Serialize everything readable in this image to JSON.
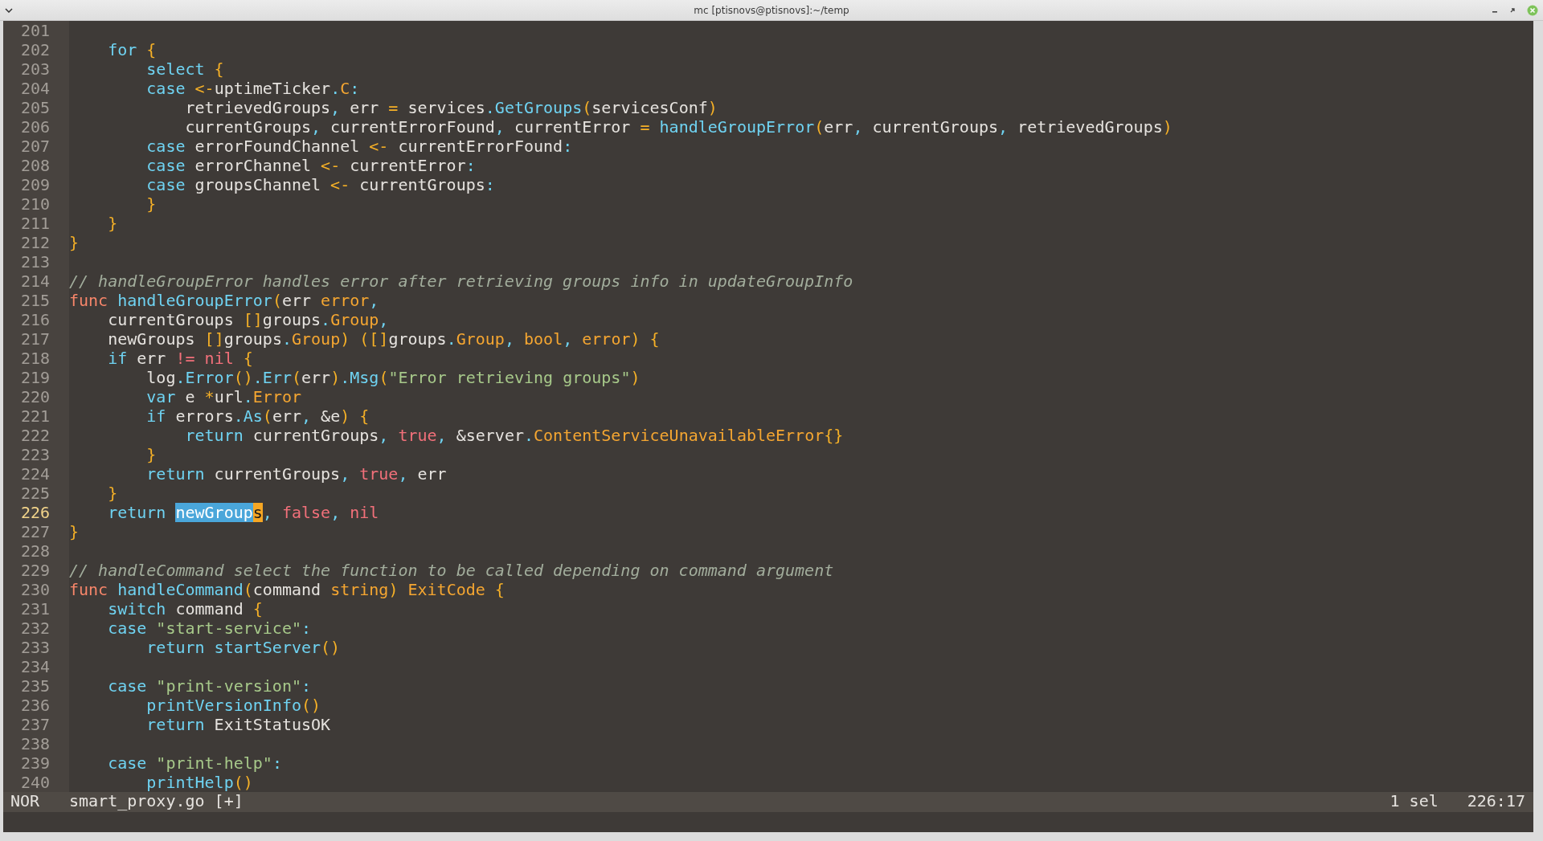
{
  "window": {
    "title": "mc [ptisnovs@ptisnovs]:~/temp"
  },
  "editor": {
    "lines": [
      {
        "number": "201",
        "current": false
      },
      {
        "number": "202",
        "current": false,
        "tokens": [
          {
            "kind": "keyword",
            "text": "    for"
          },
          {
            "kind": "bracket",
            "text": " {"
          }
        ]
      },
      {
        "number": "203",
        "current": false,
        "tokens": [
          {
            "kind": "keyword",
            "text": "        select"
          },
          {
            "kind": "bracket",
            "text": " {"
          }
        ]
      },
      {
        "number": "204",
        "current": false,
        "tokens": [
          {
            "kind": "keyword",
            "text": "        case"
          },
          {
            "kind": "operator",
            "text": " <-"
          },
          {
            "kind": "plain",
            "text": "uptimeTicker"
          },
          {
            "kind": "delim",
            "text": "."
          },
          {
            "kind": "type",
            "text": "C"
          },
          {
            "kind": "delim",
            "text": ":"
          }
        ]
      },
      {
        "number": "205",
        "current": false,
        "tokens": [
          {
            "kind": "plain",
            "text": "            retrievedGroups"
          },
          {
            "kind": "delim",
            "text": ","
          },
          {
            "kind": "plain",
            "text": " err"
          },
          {
            "kind": "operator",
            "text": " ="
          },
          {
            "kind": "plain",
            "text": " services"
          },
          {
            "kind": "delim",
            "text": "."
          },
          {
            "kind": "keyword",
            "text": "GetGroups"
          },
          {
            "kind": "bracket",
            "text": "("
          },
          {
            "kind": "plain",
            "text": "servicesConf"
          },
          {
            "kind": "bracket",
            "text": ")"
          }
        ]
      },
      {
        "number": "206",
        "current": false,
        "tokens": [
          {
            "kind": "plain",
            "text": "            currentGroups"
          },
          {
            "kind": "delim",
            "text": ","
          },
          {
            "kind": "plain",
            "text": " currentErrorFound"
          },
          {
            "kind": "delim",
            "text": ","
          },
          {
            "kind": "plain",
            "text": " currentError"
          },
          {
            "kind": "operator",
            "text": " ="
          },
          {
            "kind": "keyword",
            "text": " handleGroupError"
          },
          {
            "kind": "bracket",
            "text": "("
          },
          {
            "kind": "plain",
            "text": "err"
          },
          {
            "kind": "delim",
            "text": ","
          },
          {
            "kind": "plain",
            "text": " currentGroups"
          },
          {
            "kind": "delim",
            "text": ","
          },
          {
            "kind": "plain",
            "text": " retrievedGroups"
          },
          {
            "kind": "bracket",
            "text": ")"
          }
        ]
      },
      {
        "number": "207",
        "current": false,
        "tokens": [
          {
            "kind": "keyword",
            "text": "        case"
          },
          {
            "kind": "plain",
            "text": " errorFoundChannel"
          },
          {
            "kind": "operator",
            "text": " <-"
          },
          {
            "kind": "plain",
            "text": " currentErrorFound"
          },
          {
            "kind": "delim",
            "text": ":"
          }
        ]
      },
      {
        "number": "208",
        "current": false,
        "tokens": [
          {
            "kind": "keyword",
            "text": "        case"
          },
          {
            "kind": "plain",
            "text": " errorChannel"
          },
          {
            "kind": "operator",
            "text": " <-"
          },
          {
            "kind": "plain",
            "text": " currentError"
          },
          {
            "kind": "delim",
            "text": ":"
          }
        ]
      },
      {
        "number": "209",
        "current": false,
        "tokens": [
          {
            "kind": "keyword",
            "text": "        case"
          },
          {
            "kind": "plain",
            "text": " groupsChannel"
          },
          {
            "kind": "operator",
            "text": " <-"
          },
          {
            "kind": "plain",
            "text": " currentGroups"
          },
          {
            "kind": "delim",
            "text": ":"
          }
        ]
      },
      {
        "number": "210",
        "current": false,
        "tokens": [
          {
            "kind": "bracket",
            "text": "        }"
          }
        ]
      },
      {
        "number": "211",
        "current": false,
        "tokens": [
          {
            "kind": "bracket",
            "text": "    }"
          }
        ]
      },
      {
        "number": "212",
        "current": false,
        "tokens": [
          {
            "kind": "bracket",
            "text": "}"
          }
        ]
      },
      {
        "number": "213",
        "current": false
      },
      {
        "number": "214",
        "current": false,
        "tokens": [
          {
            "kind": "comment",
            "text": "// handleGroupError handles error after retrieving groups info in updateGroupInfo"
          }
        ]
      },
      {
        "number": "215",
        "current": false,
        "tokens": [
          {
            "kind": "storage",
            "text": "func"
          },
          {
            "kind": "keyword",
            "text": " handleGroupError"
          },
          {
            "kind": "bracket",
            "text": "("
          },
          {
            "kind": "plain",
            "text": "err"
          },
          {
            "kind": "type",
            "text": " error"
          },
          {
            "kind": "delim",
            "text": ","
          }
        ]
      },
      {
        "number": "216",
        "current": false,
        "tokens": [
          {
            "kind": "plain",
            "text": "    currentGroups"
          },
          {
            "kind": "bracket",
            "text": " []"
          },
          {
            "kind": "plain",
            "text": "groups"
          },
          {
            "kind": "delim",
            "text": "."
          },
          {
            "kind": "type",
            "text": "Group"
          },
          {
            "kind": "delim",
            "text": ","
          }
        ]
      },
      {
        "number": "217",
        "current": false,
        "tokens": [
          {
            "kind": "plain",
            "text": "    newGroups"
          },
          {
            "kind": "bracket",
            "text": " []"
          },
          {
            "kind": "plain",
            "text": "groups"
          },
          {
            "kind": "delim",
            "text": "."
          },
          {
            "kind": "type",
            "text": "Group"
          },
          {
            "kind": "bracket",
            "text": ")"
          },
          {
            "kind": "bracket",
            "text": " ([]"
          },
          {
            "kind": "plain",
            "text": "groups"
          },
          {
            "kind": "delim",
            "text": "."
          },
          {
            "kind": "type",
            "text": "Group"
          },
          {
            "kind": "delim",
            "text": ","
          },
          {
            "kind": "type",
            "text": " bool"
          },
          {
            "kind": "delim",
            "text": ","
          },
          {
            "kind": "type",
            "text": " error"
          },
          {
            "kind": "bracket",
            "text": ")"
          },
          {
            "kind": "bracket",
            "text": " {"
          }
        ]
      },
      {
        "number": "218",
        "current": false,
        "tokens": [
          {
            "kind": "keyword",
            "text": "    if"
          },
          {
            "kind": "plain",
            "text": " err"
          },
          {
            "kind": "compare",
            "text": " !="
          },
          {
            "kind": "constant",
            "text": " nil"
          },
          {
            "kind": "bracket",
            "text": " {"
          }
        ]
      },
      {
        "number": "219",
        "current": false,
        "tokens": [
          {
            "kind": "plain",
            "text": "        log"
          },
          {
            "kind": "delim",
            "text": "."
          },
          {
            "kind": "keyword",
            "text": "Error"
          },
          {
            "kind": "bracket",
            "text": "()"
          },
          {
            "kind": "delim",
            "text": "."
          },
          {
            "kind": "keyword",
            "text": "Err"
          },
          {
            "kind": "bracket",
            "text": "("
          },
          {
            "kind": "plain",
            "text": "err"
          },
          {
            "kind": "bracket",
            "text": ")"
          },
          {
            "kind": "delim",
            "text": "."
          },
          {
            "kind": "keyword",
            "text": "Msg"
          },
          {
            "kind": "bracket",
            "text": "("
          },
          {
            "kind": "string",
            "text": "\"Error retrieving groups\""
          },
          {
            "kind": "bracket",
            "text": ")"
          }
        ]
      },
      {
        "number": "220",
        "current": false,
        "tokens": [
          {
            "kind": "keyword",
            "text": "        var"
          },
          {
            "kind": "plain",
            "text": " e"
          },
          {
            "kind": "operator",
            "text": " *"
          },
          {
            "kind": "plain",
            "text": "url"
          },
          {
            "kind": "delim",
            "text": "."
          },
          {
            "kind": "type",
            "text": "Error"
          }
        ]
      },
      {
        "number": "221",
        "current": false,
        "tokens": [
          {
            "kind": "keyword",
            "text": "        if"
          },
          {
            "kind": "plain",
            "text": " errors"
          },
          {
            "kind": "delim",
            "text": "."
          },
          {
            "kind": "keyword",
            "text": "As"
          },
          {
            "kind": "bracket",
            "text": "("
          },
          {
            "kind": "plain",
            "text": "err"
          },
          {
            "kind": "delim",
            "text": ","
          },
          {
            "kind": "plain",
            "text": " &e"
          },
          {
            "kind": "bracket",
            "text": ")"
          },
          {
            "kind": "bracket",
            "text": " {"
          }
        ]
      },
      {
        "number": "222",
        "current": false,
        "tokens": [
          {
            "kind": "keyword",
            "text": "            return"
          },
          {
            "kind": "plain",
            "text": " currentGroups"
          },
          {
            "kind": "delim",
            "text": ","
          },
          {
            "kind": "constant",
            "text": " true"
          },
          {
            "kind": "delim",
            "text": ","
          },
          {
            "kind": "plain",
            "text": " &server"
          },
          {
            "kind": "delim",
            "text": "."
          },
          {
            "kind": "type",
            "text": "ContentServiceUnavailableError"
          },
          {
            "kind": "bracket",
            "text": "{}"
          }
        ]
      },
      {
        "number": "223",
        "current": false,
        "tokens": [
          {
            "kind": "bracket",
            "text": "        }"
          }
        ]
      },
      {
        "number": "224",
        "current": false,
        "tokens": [
          {
            "kind": "keyword",
            "text": "        return"
          },
          {
            "kind": "plain",
            "text": " currentGroups"
          },
          {
            "kind": "delim",
            "text": ","
          },
          {
            "kind": "constant",
            "text": " true"
          },
          {
            "kind": "delim",
            "text": ","
          },
          {
            "kind": "plain",
            "text": " err"
          }
        ]
      },
      {
        "number": "225",
        "current": false,
        "tokens": [
          {
            "kind": "bracket",
            "text": "    }"
          }
        ]
      },
      {
        "number": "226",
        "current": true,
        "tokens": [
          {
            "kind": "keyword",
            "text": "    return "
          },
          {
            "kind": "selection",
            "text": "newGroup"
          },
          {
            "kind": "cursor",
            "text": "s"
          },
          {
            "kind": "delim",
            "text": ","
          },
          {
            "kind": "constant",
            "text": " false"
          },
          {
            "kind": "delim",
            "text": ","
          },
          {
            "kind": "constant",
            "text": " nil"
          }
        ]
      },
      {
        "number": "227",
        "current": false,
        "tokens": [
          {
            "kind": "bracket",
            "text": "}"
          }
        ]
      },
      {
        "number": "228",
        "current": false
      },
      {
        "number": "229",
        "current": false,
        "tokens": [
          {
            "kind": "comment",
            "text": "// handleCommand select the function to be called depending on command argument"
          }
        ]
      },
      {
        "number": "230",
        "current": false,
        "tokens": [
          {
            "kind": "storage",
            "text": "func"
          },
          {
            "kind": "keyword",
            "text": " handleCommand"
          },
          {
            "kind": "bracket",
            "text": "("
          },
          {
            "kind": "plain",
            "text": "command"
          },
          {
            "kind": "type",
            "text": " string"
          },
          {
            "kind": "bracket",
            "text": ")"
          },
          {
            "kind": "type",
            "text": " ExitCode"
          },
          {
            "kind": "bracket",
            "text": " {"
          }
        ]
      },
      {
        "number": "231",
        "current": false,
        "tokens": [
          {
            "kind": "keyword",
            "text": "    switch"
          },
          {
            "kind": "plain",
            "text": " command"
          },
          {
            "kind": "bracket",
            "text": " {"
          }
        ]
      },
      {
        "number": "232",
        "current": false,
        "tokens": [
          {
            "kind": "keyword",
            "text": "    case"
          },
          {
            "kind": "string",
            "text": " \"start-service\""
          },
          {
            "kind": "delim",
            "text": ":"
          }
        ]
      },
      {
        "number": "233",
        "current": false,
        "tokens": [
          {
            "kind": "keyword",
            "text": "        return"
          },
          {
            "kind": "keyword",
            "text": " startServer"
          },
          {
            "kind": "bracket",
            "text": "()"
          }
        ]
      },
      {
        "number": "234",
        "current": false
      },
      {
        "number": "235",
        "current": false,
        "tokens": [
          {
            "kind": "keyword",
            "text": "    case"
          },
          {
            "kind": "string",
            "text": " \"print-version\""
          },
          {
            "kind": "delim",
            "text": ":"
          }
        ]
      },
      {
        "number": "236",
        "current": false,
        "tokens": [
          {
            "kind": "keyword",
            "text": "        printVersionInfo"
          },
          {
            "kind": "bracket",
            "text": "()"
          }
        ]
      },
      {
        "number": "237",
        "current": false,
        "tokens": [
          {
            "kind": "keyword",
            "text": "        return"
          },
          {
            "kind": "plain",
            "text": " ExitStatusOK"
          }
        ]
      },
      {
        "number": "238",
        "current": false
      },
      {
        "number": "239",
        "current": false,
        "tokens": [
          {
            "kind": "keyword",
            "text": "    case"
          },
          {
            "kind": "string",
            "text": " \"print-help\""
          },
          {
            "kind": "delim",
            "text": ":"
          }
        ]
      },
      {
        "number": "240",
        "current": false,
        "tokens": [
          {
            "kind": "keyword",
            "text": "        printHelp"
          },
          {
            "kind": "bracket",
            "text": "()"
          }
        ]
      }
    ]
  },
  "status_bar": {
    "mode": "NOR",
    "file": "smart_proxy.go [+]",
    "selections": "1 sel",
    "position": "226:17"
  }
}
